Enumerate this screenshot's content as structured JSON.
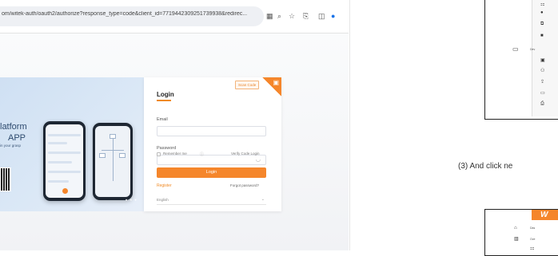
{
  "browser": {
    "url": "om/witek-auth/oauth2/authorize?response_type=code&client_id=7719442309251739938&redirec...",
    "icons": [
      "translate-icon",
      "zoom-icon",
      "star-icon",
      "extensions-icon",
      "sidepanel-icon",
      "profile-icon"
    ]
  },
  "hero": {
    "title_line1": "latform",
    "title_line2": "APP",
    "subtitle": "in your grasp"
  },
  "login": {
    "title": "Login",
    "scan_code": "Scan Code",
    "email_label": "Email",
    "password_label": "Password",
    "remember_me": "Remember me",
    "verify_code_login": "Verify Code Login",
    "login_button": "Login",
    "register": "Register",
    "forgot_password": "Forgot password?",
    "language": "English"
  },
  "doc": {
    "caption": "(3)  And click ne",
    "logo_text": "W"
  },
  "colors": {
    "accent": "#f5862b",
    "hero_bg": "#d6e5f4"
  }
}
